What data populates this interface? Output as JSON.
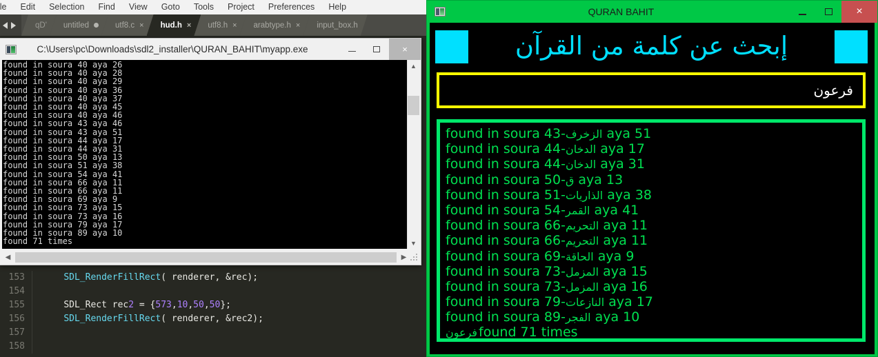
{
  "editor": {
    "menubar": [
      "ile",
      "Edit",
      "Selection",
      "Find",
      "View",
      "Goto",
      "Tools",
      "Project",
      "Preferences",
      "Help"
    ],
    "tabs": [
      {
        "label": "qD'",
        "state": "cut",
        "marker": ""
      },
      {
        "label": "untitled",
        "state": "inactive",
        "marker": "dot"
      },
      {
        "label": "utf8.c",
        "state": "inactive",
        "marker": "close"
      },
      {
        "label": "hud.h",
        "state": "active",
        "marker": "close"
      },
      {
        "label": "utf8.h",
        "state": "inactive",
        "marker": "close"
      },
      {
        "label": "arabtype.h",
        "state": "inactive",
        "marker": "close"
      },
      {
        "label": "input_box.h",
        "state": "inactive",
        "marker": ""
      }
    ],
    "code_lines": [
      {
        "number": "153",
        "fn": "SDL_RenderFillRect",
        "rest": "( renderer, &rec);",
        "indent": "    "
      },
      {
        "number": "154",
        "fn": "",
        "rest": "",
        "indent": ""
      },
      {
        "number": "155",
        "fn": "",
        "rest": "SDL_Rect rec2 = {573,10,50,50};",
        "indent": "    "
      },
      {
        "number": "156",
        "fn": "SDL_RenderFillRect",
        "rest": "( renderer, &rec2);",
        "indent": "    "
      },
      {
        "number": "157",
        "fn": "",
        "rest": "",
        "indent": ""
      },
      {
        "number": "158",
        "fn": "",
        "rest": "",
        "indent": ""
      }
    ],
    "colors": {
      "keyword": "#66d9ef",
      "number": "#ae81ff",
      "plain": "#e8e8e3",
      "background": "#272822"
    }
  },
  "console_window": {
    "title": "C:\\Users\\pc\\Downloads\\sdl2_installer\\QURAN_BAHIT\\myapp.exe",
    "icon": "console-app-icon",
    "buttons": {
      "minimize": "–",
      "maximize": "□",
      "close": "×"
    },
    "output_lines": [
      "found in soura 40 aya 26",
      "found in soura 40 aya 28",
      "found in soura 40 aya 29",
      "found in soura 40 aya 36",
      "found in soura 40 aya 37",
      "found in soura 40 aya 45",
      "found in soura 40 aya 46",
      "found in soura 43 aya 46",
      "found in soura 43 aya 51",
      "found in soura 44 aya 17",
      "found in soura 44 aya 31",
      "found in soura 50 aya 13",
      "found in soura 51 aya 38",
      "found in soura 54 aya 41",
      "found in soura 66 aya 11",
      "found in soura 66 aya 11",
      "found in soura 69 aya 9",
      "found in soura 73 aya 15",
      "found in soura 73 aya 16",
      "found in soura 79 aya 17",
      "found in soura 89 aya 10",
      "found 71 times"
    ],
    "scrollbars": {
      "up_arrow": "ⱏ",
      "down_arrow": "ⱟ",
      "left_arrow": "‹",
      "right_arrow": "›"
    }
  },
  "quran_window": {
    "title": "QURAN BAHIT",
    "icon": "app-window-icon",
    "buttons": {
      "minimize": "–",
      "maximize": "□",
      "close": "×"
    },
    "header_text": "إبحث عن كلمة من القرآن",
    "search_value": "فرعون",
    "colors": {
      "titlebar": "#00c846",
      "header_text": "#00dfff",
      "accent_square": "#00e0ff",
      "search_border": "#ffff00",
      "results_border": "#00e86a",
      "results_text": "#00e050",
      "close_button": "#c75050"
    },
    "results": [
      {
        "prefix": "found in soura 43-",
        "sura": "الزخرف",
        "suffix": "aya 51"
      },
      {
        "prefix": "found in soura 44-",
        "sura": "الدخان",
        "suffix": "aya 17"
      },
      {
        "prefix": "found in soura 44-",
        "sura": "الدخان",
        "suffix": "aya 31"
      },
      {
        "prefix": "found in soura 50-",
        "sura": "ق",
        "suffix": "aya 13"
      },
      {
        "prefix": "found in soura 51-",
        "sura": "الذاريات",
        "suffix": "aya 38"
      },
      {
        "prefix": "found in soura 54-",
        "sura": "القمر",
        "suffix": "aya 41"
      },
      {
        "prefix": "found in soura 66-",
        "sura": "التحريم",
        "suffix": "aya 11"
      },
      {
        "prefix": "found in soura 66-",
        "sura": "التحريم",
        "suffix": "aya 11"
      },
      {
        "prefix": "found in soura 69-",
        "sura": "الحاقة",
        "suffix": "aya 9"
      },
      {
        "prefix": "found in soura 73-",
        "sura": "المزمل",
        "suffix": "aya 15"
      },
      {
        "prefix": "found in soura 73-",
        "sura": "المزمل",
        "suffix": "aya 16"
      },
      {
        "prefix": "found in soura 79-",
        "sura": "النازعات",
        "suffix": "aya 17"
      },
      {
        "prefix": "found in soura 89-",
        "sura": "الفجر",
        "suffix": "aya 10"
      }
    ],
    "summary": {
      "word": "فرعون",
      "text": "found 71 times"
    }
  }
}
